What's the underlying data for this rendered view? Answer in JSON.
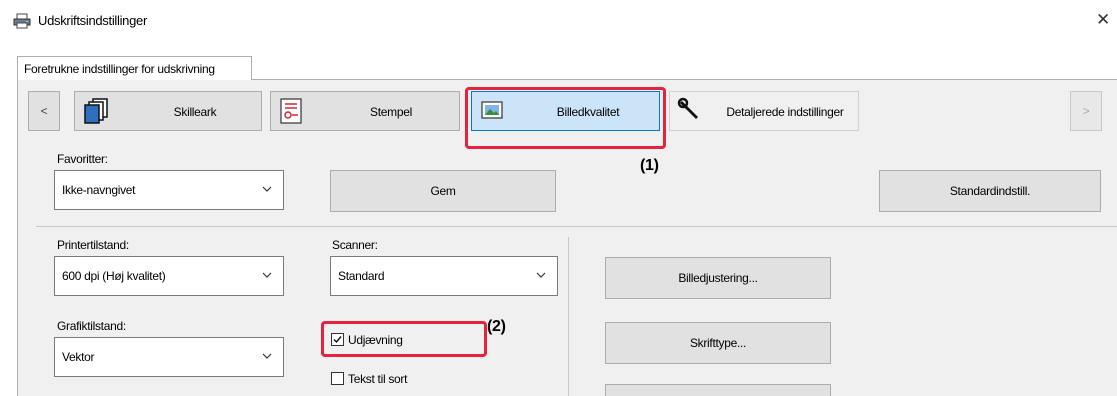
{
  "window": {
    "title": "Udskriftsindstillinger",
    "close_glyph": "✕"
  },
  "tab": {
    "label": "Foretrukne indstillinger for udskrivning"
  },
  "toolbar": {
    "prev_glyph": "<",
    "next_glyph": ">",
    "items": [
      {
        "label": "Skilleark",
        "icon": "separator-pages-icon"
      },
      {
        "label": "Stempel",
        "icon": "stamp-icon"
      },
      {
        "label": "Billedkvalitet",
        "icon": "image-quality-icon",
        "selected": true
      },
      {
        "label": "Detaljerede indstillinger",
        "icon": "wrench-icon"
      }
    ]
  },
  "favorites": {
    "label": "Favoritter:",
    "value": "Ikke-navngivet",
    "save_label": "Gem",
    "defaults_label": "Standardindstill."
  },
  "printer_mode": {
    "label": "Printertilstand:",
    "value": "600 dpi (Høj kvalitet)"
  },
  "scanner": {
    "label": "Scanner:",
    "value": "Standard"
  },
  "graphics_mode": {
    "label": "Grafiktilstand:",
    "value": "Vektor"
  },
  "smoothing": {
    "label": "Udjævning",
    "checked": true
  },
  "text_to_black": {
    "label": "Tekst til sort",
    "checked": false
  },
  "buttons": {
    "image_adjust": "Billedjustering...",
    "font": "Skrifttype..."
  },
  "callouts": {
    "one": "(1)",
    "two": "(2)"
  },
  "colors": {
    "accent": "#0078d7",
    "highlight": "#e5233d",
    "selected_bg": "#cce4f7"
  }
}
